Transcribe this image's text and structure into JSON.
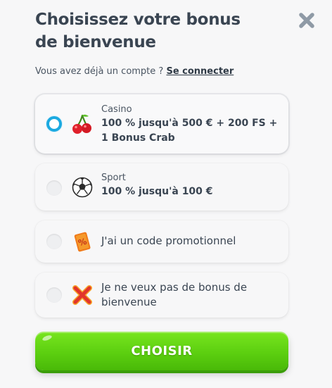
{
  "header": {
    "title": "Choisissez votre bonus de bienvenue"
  },
  "login": {
    "prompt": "Vous avez déjà un compte ?",
    "link_label": "Se connecter"
  },
  "options": [
    {
      "category": "Casino",
      "title": "100 % jusqu'à 500 € + 200 FS + 1 Bonus Crab",
      "icon": "cherry-icon",
      "selected": true
    },
    {
      "category": "Sport",
      "title": "100 % jusqu'à 100 €",
      "icon": "soccer-ball-icon",
      "selected": false
    },
    {
      "title": "J'ai un code promotionnel",
      "icon": "promo-ticket-icon",
      "selected": false
    },
    {
      "title": "Je ne veux pas de bonus de bienvenue",
      "icon": "red-cross-icon",
      "selected": false
    }
  ],
  "cta": {
    "label": "CHOISIR"
  },
  "colors": {
    "accent_green": "#5ccf10",
    "radio_selected": "#1ba9e0",
    "text_dark": "#3a4552",
    "close_icon": "#8f9aa6"
  }
}
